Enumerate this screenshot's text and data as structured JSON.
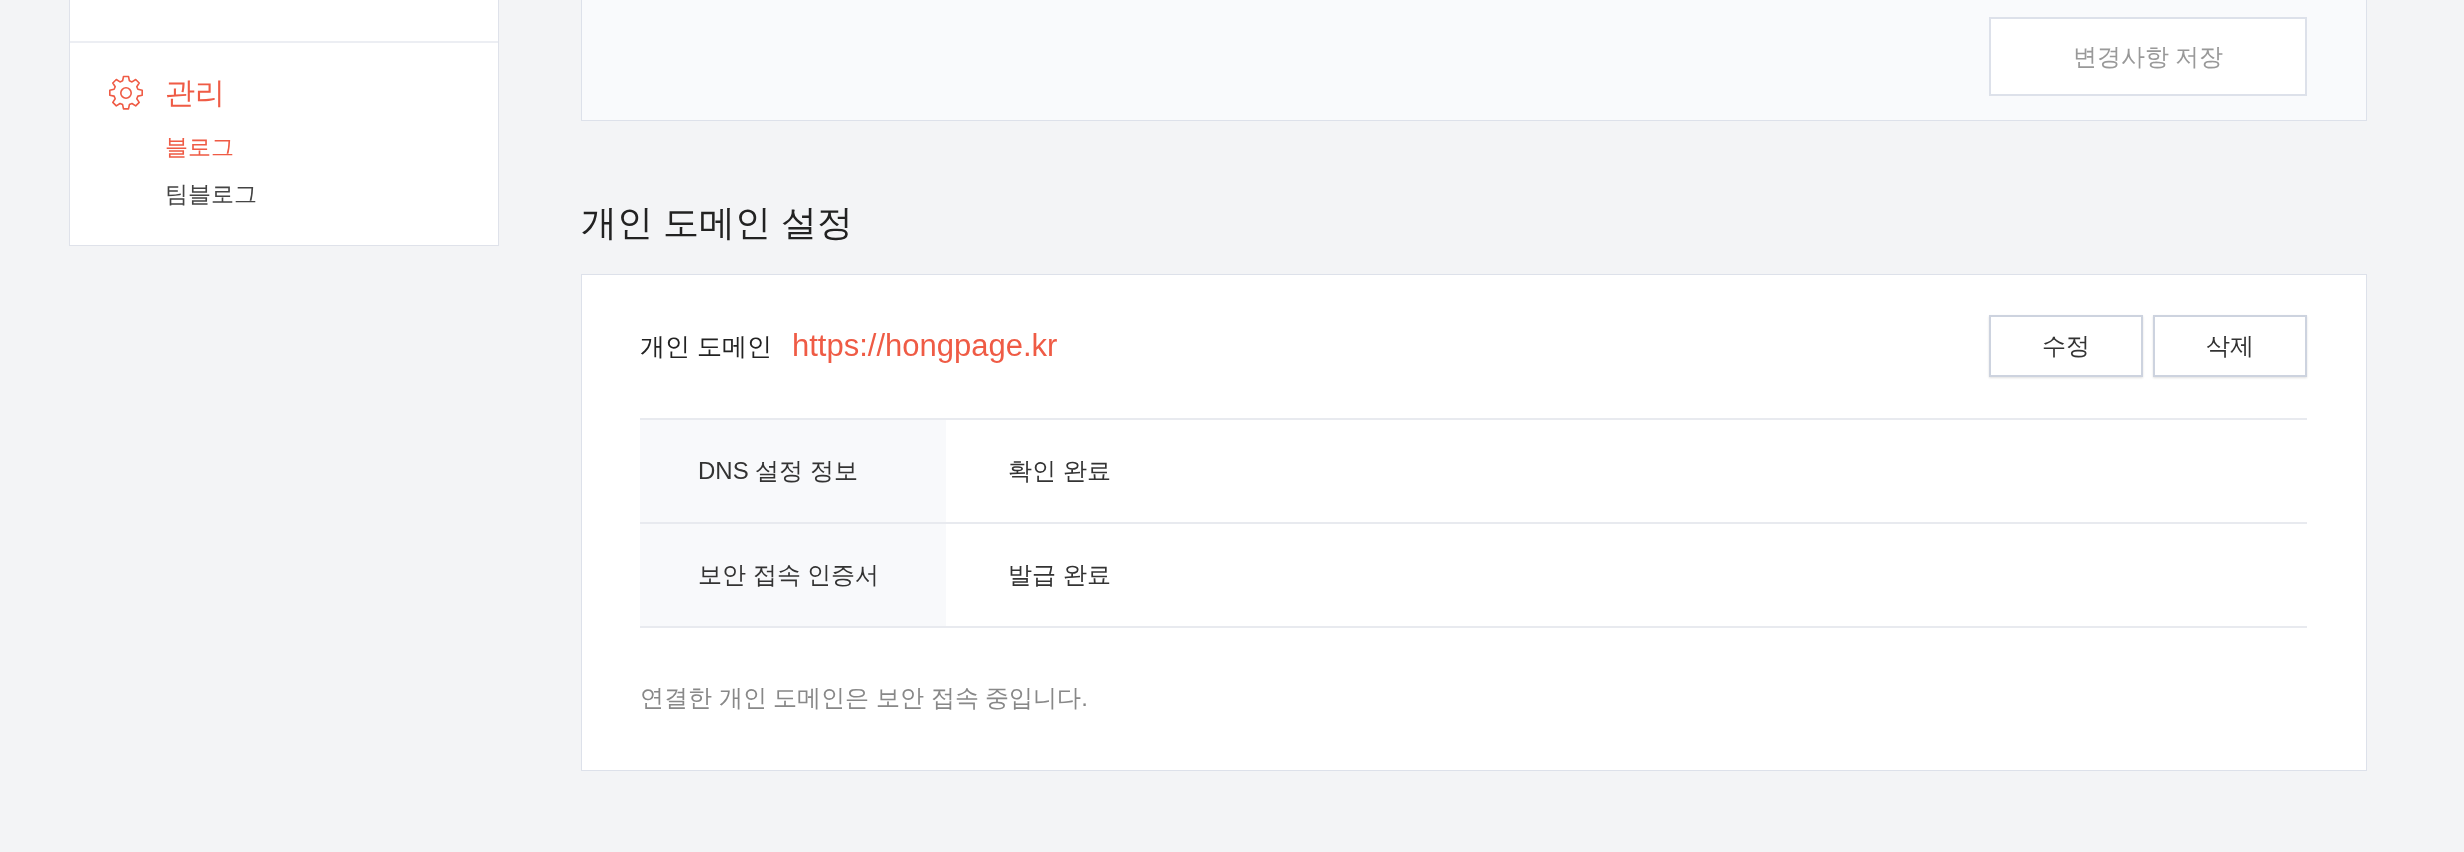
{
  "sidebar": {
    "sections": [
      {
        "title": "관리",
        "selected": true,
        "items": [
          {
            "label": "블로그",
            "selected": true
          },
          {
            "label": "팀블로그",
            "selected": false
          }
        ]
      }
    ]
  },
  "settings_panel": {
    "save_button": {
      "label": "변경사항 저장",
      "disabled": true
    }
  },
  "domain_section": {
    "title": "개인 도메인 설정",
    "domain_label": "개인 도메인",
    "domain_url": "https://hongpage.kr",
    "buttons": [
      {
        "label": "수정"
      },
      {
        "label": "삭제"
      }
    ],
    "status_rows": [
      {
        "label": "DNS 설정 정보",
        "value": "확인 완료"
      },
      {
        "label": "보안 접속 인증서",
        "value": "발급 완료"
      }
    ],
    "note": "연결한 개인 도메인은 보안 접속 중입니다."
  }
}
